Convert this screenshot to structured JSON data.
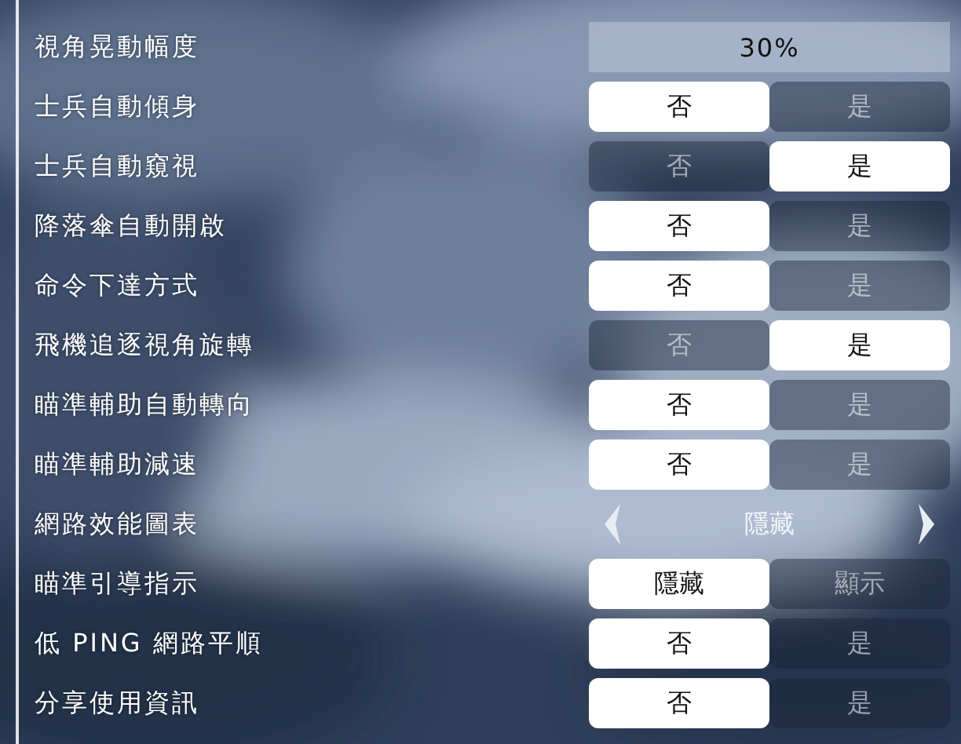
{
  "settings": [
    {
      "kind": "value",
      "label": "視角晃動幅度",
      "value": "30%"
    },
    {
      "kind": "toggle",
      "label": "士兵自動傾身",
      "options": [
        {
          "label": "否",
          "selected": true
        },
        {
          "label": "是",
          "selected": false
        }
      ]
    },
    {
      "kind": "toggle",
      "label": "士兵自動窺視",
      "options": [
        {
          "label": "否",
          "selected": false
        },
        {
          "label": "是",
          "selected": true
        }
      ]
    },
    {
      "kind": "toggle",
      "label": "降落傘自動開啟",
      "options": [
        {
          "label": "否",
          "selected": true
        },
        {
          "label": "是",
          "selected": false
        }
      ]
    },
    {
      "kind": "toggle",
      "label": "命令下達方式",
      "options": [
        {
          "label": "否",
          "selected": true
        },
        {
          "label": "是",
          "selected": false
        }
      ]
    },
    {
      "kind": "toggle",
      "label": "飛機追逐視角旋轉",
      "options": [
        {
          "label": "否",
          "selected": false
        },
        {
          "label": "是",
          "selected": true
        }
      ]
    },
    {
      "kind": "toggle",
      "label": "瞄準輔助自動轉向",
      "options": [
        {
          "label": "否",
          "selected": true
        },
        {
          "label": "是",
          "selected": false
        }
      ]
    },
    {
      "kind": "toggle",
      "label": "瞄準輔助減速",
      "options": [
        {
          "label": "否",
          "selected": true
        },
        {
          "label": "是",
          "selected": false
        }
      ]
    },
    {
      "kind": "selector",
      "label": "網路效能圖表",
      "value": "隱藏"
    },
    {
      "kind": "toggle",
      "label": "瞄準引導指示",
      "options": [
        {
          "label": "隱藏",
          "selected": true
        },
        {
          "label": "顯示",
          "selected": false
        }
      ]
    },
    {
      "kind": "toggle",
      "label": "低 PING 網路平順",
      "options": [
        {
          "label": "否",
          "selected": true
        },
        {
          "label": "是",
          "selected": false
        }
      ]
    },
    {
      "kind": "toggle",
      "label": "分享使用資訊",
      "options": [
        {
          "label": "否",
          "selected": true
        },
        {
          "label": "是",
          "selected": false
        }
      ]
    }
  ]
}
